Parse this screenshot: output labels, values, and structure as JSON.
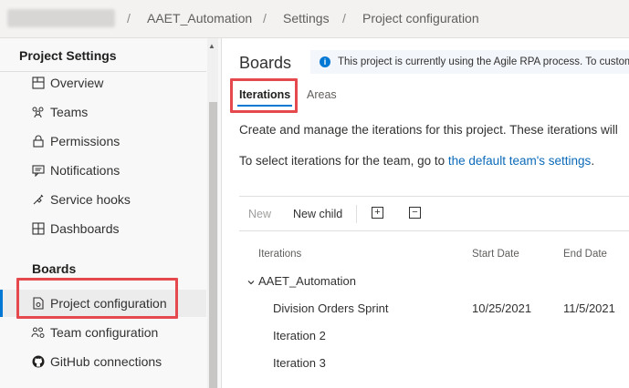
{
  "breadcrumb": {
    "separator": "/",
    "items": [
      "AAET_Automation",
      "Settings",
      "Project configuration"
    ]
  },
  "sidebar": {
    "title": "Project Settings",
    "general_items": [
      {
        "label": "Overview",
        "icon": "overview-icon"
      },
      {
        "label": "Teams",
        "icon": "teams-icon"
      },
      {
        "label": "Permissions",
        "icon": "lock-icon"
      },
      {
        "label": "Notifications",
        "icon": "notification-icon"
      },
      {
        "label": "Service hooks",
        "icon": "service-hooks-icon"
      },
      {
        "label": "Dashboards",
        "icon": "dashboards-icon"
      }
    ],
    "boards_section": "Boards",
    "boards_items": [
      {
        "label": "Project configuration",
        "icon": "project-configuration-icon",
        "selected": true
      },
      {
        "label": "Team configuration",
        "icon": "team-configuration-icon"
      },
      {
        "label": "GitHub connections",
        "icon": "github-icon"
      }
    ]
  },
  "main": {
    "title": "Boards",
    "info_icon_glyph": "i",
    "info_text": "This project is currently using the Agile RPA process. To customize",
    "tabs": [
      {
        "label": "Iterations",
        "active": true
      },
      {
        "label": "Areas",
        "active": false
      }
    ],
    "description": "Create and manage the iterations for this project. These iterations will",
    "team_prompt": "To select iterations for the team, go to",
    "team_link": "the default team's settings",
    "team_suffix": ".",
    "toolbar": {
      "new_label": "New",
      "new_child_label": "New child",
      "expand_glyph": "+",
      "collapse_glyph": "−"
    },
    "table": {
      "columns": [
        "Iterations",
        "Start Date",
        "End Date"
      ],
      "root": "AAET_Automation",
      "rows": [
        {
          "name": "Division Orders Sprint",
          "start": "10/25/2021",
          "end": "11/5/2021"
        },
        {
          "name": "Iteration 2",
          "start": "",
          "end": ""
        },
        {
          "name": "Iteration 3",
          "start": "",
          "end": ""
        }
      ]
    }
  },
  "colors": {
    "accent": "#0078d4",
    "highlight": "#e5494d",
    "link": "#0b6ab8"
  }
}
